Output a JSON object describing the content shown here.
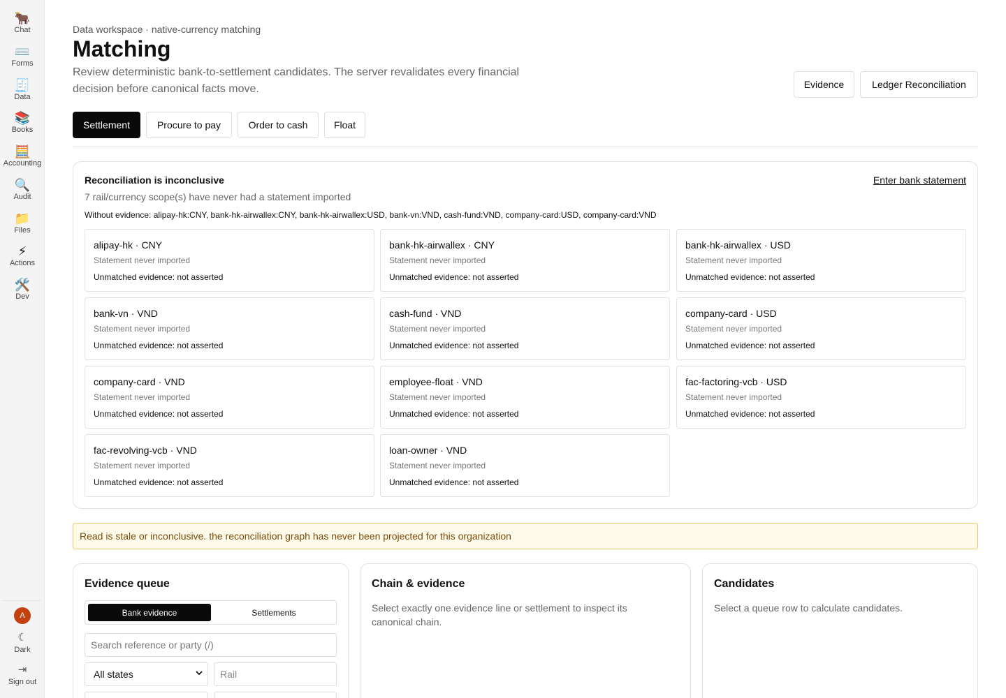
{
  "sidebar": {
    "items": [
      {
        "icon": "🐂",
        "label": "Chat"
      },
      {
        "icon": "⌨️",
        "label": "Forms"
      },
      {
        "icon": "🧾",
        "label": "Data"
      },
      {
        "icon": "📚",
        "label": "Books"
      },
      {
        "icon": "🧮",
        "label": "Accounting"
      },
      {
        "icon": "🔍",
        "label": "Audit"
      },
      {
        "icon": "📁",
        "label": "Files"
      },
      {
        "icon": "⚡",
        "label": "Actions"
      },
      {
        "icon": "🛠️",
        "label": "Dev"
      }
    ],
    "avatar_initial": "A",
    "dark_icon": "☾",
    "dark_label": "Dark",
    "signout_icon": "⇥",
    "signout_label": "Sign out"
  },
  "header": {
    "breadcrumb": "Data workspace · native-currency matching",
    "title": "Matching",
    "description": "Review deterministic bank-to-settlement candidates. The server revalidates every financial decision before canonical facts move.",
    "evidence_button": "Evidence",
    "ledger_button": "Ledger Reconciliation"
  },
  "tabs": [
    "Settlement",
    "Procure to pay",
    "Order to cash",
    "Float"
  ],
  "reconciliation": {
    "title": "Reconciliation is inconclusive",
    "link": "Enter bank statement",
    "subtitle": "7 rail/currency scope(s) have never had a statement imported",
    "without_evidence": "Without evidence: alipay-hk:CNY, bank-hk-airwallex:CNY, bank-hk-airwallex:USD, bank-vn:VND, cash-fund:VND, company-card:USD, company-card:VND",
    "scopes": [
      {
        "name": "alipay-hk · CNY",
        "status": "Statement never imported",
        "unmatched": "Unmatched evidence: not asserted"
      },
      {
        "name": "bank-hk-airwallex · CNY",
        "status": "Statement never imported",
        "unmatched": "Unmatched evidence: not asserted"
      },
      {
        "name": "bank-hk-airwallex · USD",
        "status": "Statement never imported",
        "unmatched": "Unmatched evidence: not asserted"
      },
      {
        "name": "bank-vn · VND",
        "status": "Statement never imported",
        "unmatched": "Unmatched evidence: not asserted"
      },
      {
        "name": "cash-fund · VND",
        "status": "Statement never imported",
        "unmatched": "Unmatched evidence: not asserted"
      },
      {
        "name": "company-card · USD",
        "status": "Statement never imported",
        "unmatched": "Unmatched evidence: not asserted"
      },
      {
        "name": "company-card · VND",
        "status": "Statement never imported",
        "unmatched": "Unmatched evidence: not asserted"
      },
      {
        "name": "employee-float · VND",
        "status": "Statement never imported",
        "unmatched": "Unmatched evidence: not asserted"
      },
      {
        "name": "fac-factoring-vcb · USD",
        "status": "Statement never imported",
        "unmatched": "Unmatched evidence: not asserted"
      },
      {
        "name": "fac-revolving-vcb · VND",
        "status": "Statement never imported",
        "unmatched": "Unmatched evidence: not asserted"
      },
      {
        "name": "loan-owner · VND",
        "status": "Statement never imported",
        "unmatched": "Unmatched evidence: not asserted"
      }
    ]
  },
  "warning": "Read is stale or inconclusive. the reconciliation graph has never been projected for this organization",
  "evidence_queue": {
    "title": "Evidence queue",
    "seg_bank": "Bank evidence",
    "seg_settlements": "Settlements",
    "search_placeholder": "Search reference or party (/)",
    "state_select": "All states",
    "rail_placeholder": "Rail"
  },
  "chain": {
    "title": "Chain & evidence",
    "text": "Select exactly one evidence line or settlement to inspect its canonical chain."
  },
  "candidates": {
    "title": "Candidates",
    "text": "Select a queue row to calculate candidates."
  },
  "colors": {
    "accent": "#0a0a0a",
    "warning_bg": "#fffbeb",
    "warning_border": "#eac76b",
    "avatar": "#c2410c"
  }
}
